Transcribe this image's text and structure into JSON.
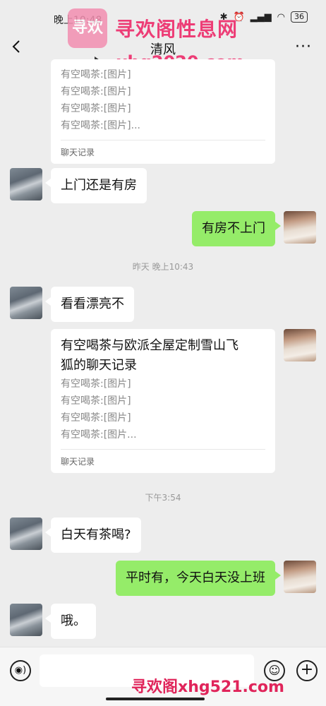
{
  "status": {
    "time": "晚上10:48",
    "battery": "36"
  },
  "nav": {
    "title": "清风"
  },
  "watermark": {
    "logo": "寻欢",
    "title": "寻欢阁性息网",
    "url": "xhg2020.com",
    "bottom": "寻欢阁xhg521.com"
  },
  "messages": {
    "card1": {
      "lines": [
        "有空喝茶:[图片]",
        "有空喝茶:[图片]",
        "有空喝茶:[图片]",
        "有空喝茶:[图片]..."
      ],
      "footer": "聊天记录"
    },
    "m1": "上门还是有房",
    "m2": "有房不上门",
    "ts1": "昨天 晚上10:43",
    "m3": "看看漂亮不",
    "card2": {
      "title_line1": "有空喝茶与欧派全屋定制雪山飞",
      "title_line2": "狐的聊天记录",
      "lines": [
        "有空喝茶:[图片]",
        "有空喝茶:[图片]",
        "有空喝茶:[图片]",
        "有空喝茶:[图片..."
      ],
      "footer": "聊天记录"
    },
    "ts2": "下午3:54",
    "m4": "白天有茶喝?",
    "m5": "平时有，今天白天没上班",
    "m6": "哦。"
  },
  "icons": {
    "back": "back-arrow-icon",
    "more": "more-icon",
    "voice": "voice-icon",
    "emoji": "emoji-icon",
    "plus": "plus-icon"
  }
}
